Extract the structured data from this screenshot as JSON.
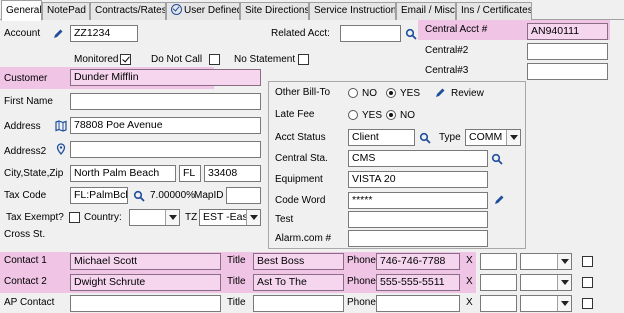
{
  "tabs": [
    {
      "label": "General",
      "active": true
    },
    {
      "label": "NotePad"
    },
    {
      "label": "Contracts/Rates"
    },
    {
      "label": "User Defined",
      "icon": "check-circle-icon"
    },
    {
      "label": "Site Directions"
    },
    {
      "label": "Service Instructions"
    },
    {
      "label": "Email / Misc"
    },
    {
      "label": "Ins / Certificates"
    }
  ],
  "account": {
    "label": "Account",
    "value": "ZZ1234",
    "monitored_label": "Monitored",
    "monitored": true,
    "do_not_call_label": "Do Not Call",
    "do_not_call": false,
    "no_statement_label": "No Statement",
    "no_statement": false
  },
  "related_acct": {
    "label": "Related Acct:",
    "value": ""
  },
  "central": {
    "acct_label": "Central Acct #",
    "acct_value": "AN940111",
    "num2_label": "Central#2",
    "num2_value": "",
    "num3_label": "Central#3",
    "num3_value": ""
  },
  "customer": {
    "label": "Customer",
    "value": "Dunder Mifflin"
  },
  "first_name": {
    "label": "First Name",
    "value": ""
  },
  "address": {
    "label": "Address",
    "value": "78808 Poe Avenue"
  },
  "address2": {
    "label": "Address2",
    "value": ""
  },
  "city_state_zip": {
    "label": "City,State,Zip",
    "city": "North Palm Beach",
    "state": "FL",
    "zip": "33408"
  },
  "tax": {
    "code_label": "Tax Code",
    "code_value": "FL:PalmBch",
    "rate": "7.00000%",
    "mapid_label": "MapID",
    "mapid_value": "",
    "exempt_label": "Tax Exempt?",
    "country_label": "Country:",
    "country_value": "",
    "tz_label": "TZ",
    "tz_value": "EST -East"
  },
  "cross_st": {
    "label": "Cross St."
  },
  "other_bill_to": {
    "label": "Other Bill-To",
    "no": "NO",
    "yes": "YES",
    "selected": "YES",
    "review_label": "Review"
  },
  "late_fee": {
    "label": "Late Fee",
    "yes": "YES",
    "no": "NO",
    "selected": "NO"
  },
  "acct_status": {
    "label": "Acct Status",
    "value": "Client",
    "type_label": "Type",
    "type_value": "COMM"
  },
  "central_sta": {
    "label": "Central Sta.",
    "value": "CMS"
  },
  "equipment": {
    "label": "Equipment",
    "value": "VISTA 20"
  },
  "code_word": {
    "label": "Code Word",
    "value": "*****"
  },
  "test": {
    "label": "Test",
    "value": ""
  },
  "alarm_com": {
    "label": "Alarm.com #",
    "value": ""
  },
  "contacts": [
    {
      "label": "Contact 1",
      "name": "Michael Scott",
      "title_label": "Title",
      "title": "Best Boss",
      "phone_label": "Phone",
      "phone": "746-746-7788",
      "x_label": "X",
      "highlight": true
    },
    {
      "label": "Contact 2",
      "name": "Dwight Schrute",
      "title_label": "Title",
      "title": "Ast To The",
      "phone_label": "Phone",
      "phone": "555-555-5511",
      "x_label": "X",
      "highlight": true
    },
    {
      "label": "AP Contact",
      "name": "",
      "title_label": "Title",
      "title": "",
      "phone_label": "Phone",
      "phone": "",
      "x_label": "X",
      "highlight": false
    }
  ],
  "colors": {
    "highlight": "#efc4e5",
    "icon_blue": "#1f4e9c"
  }
}
